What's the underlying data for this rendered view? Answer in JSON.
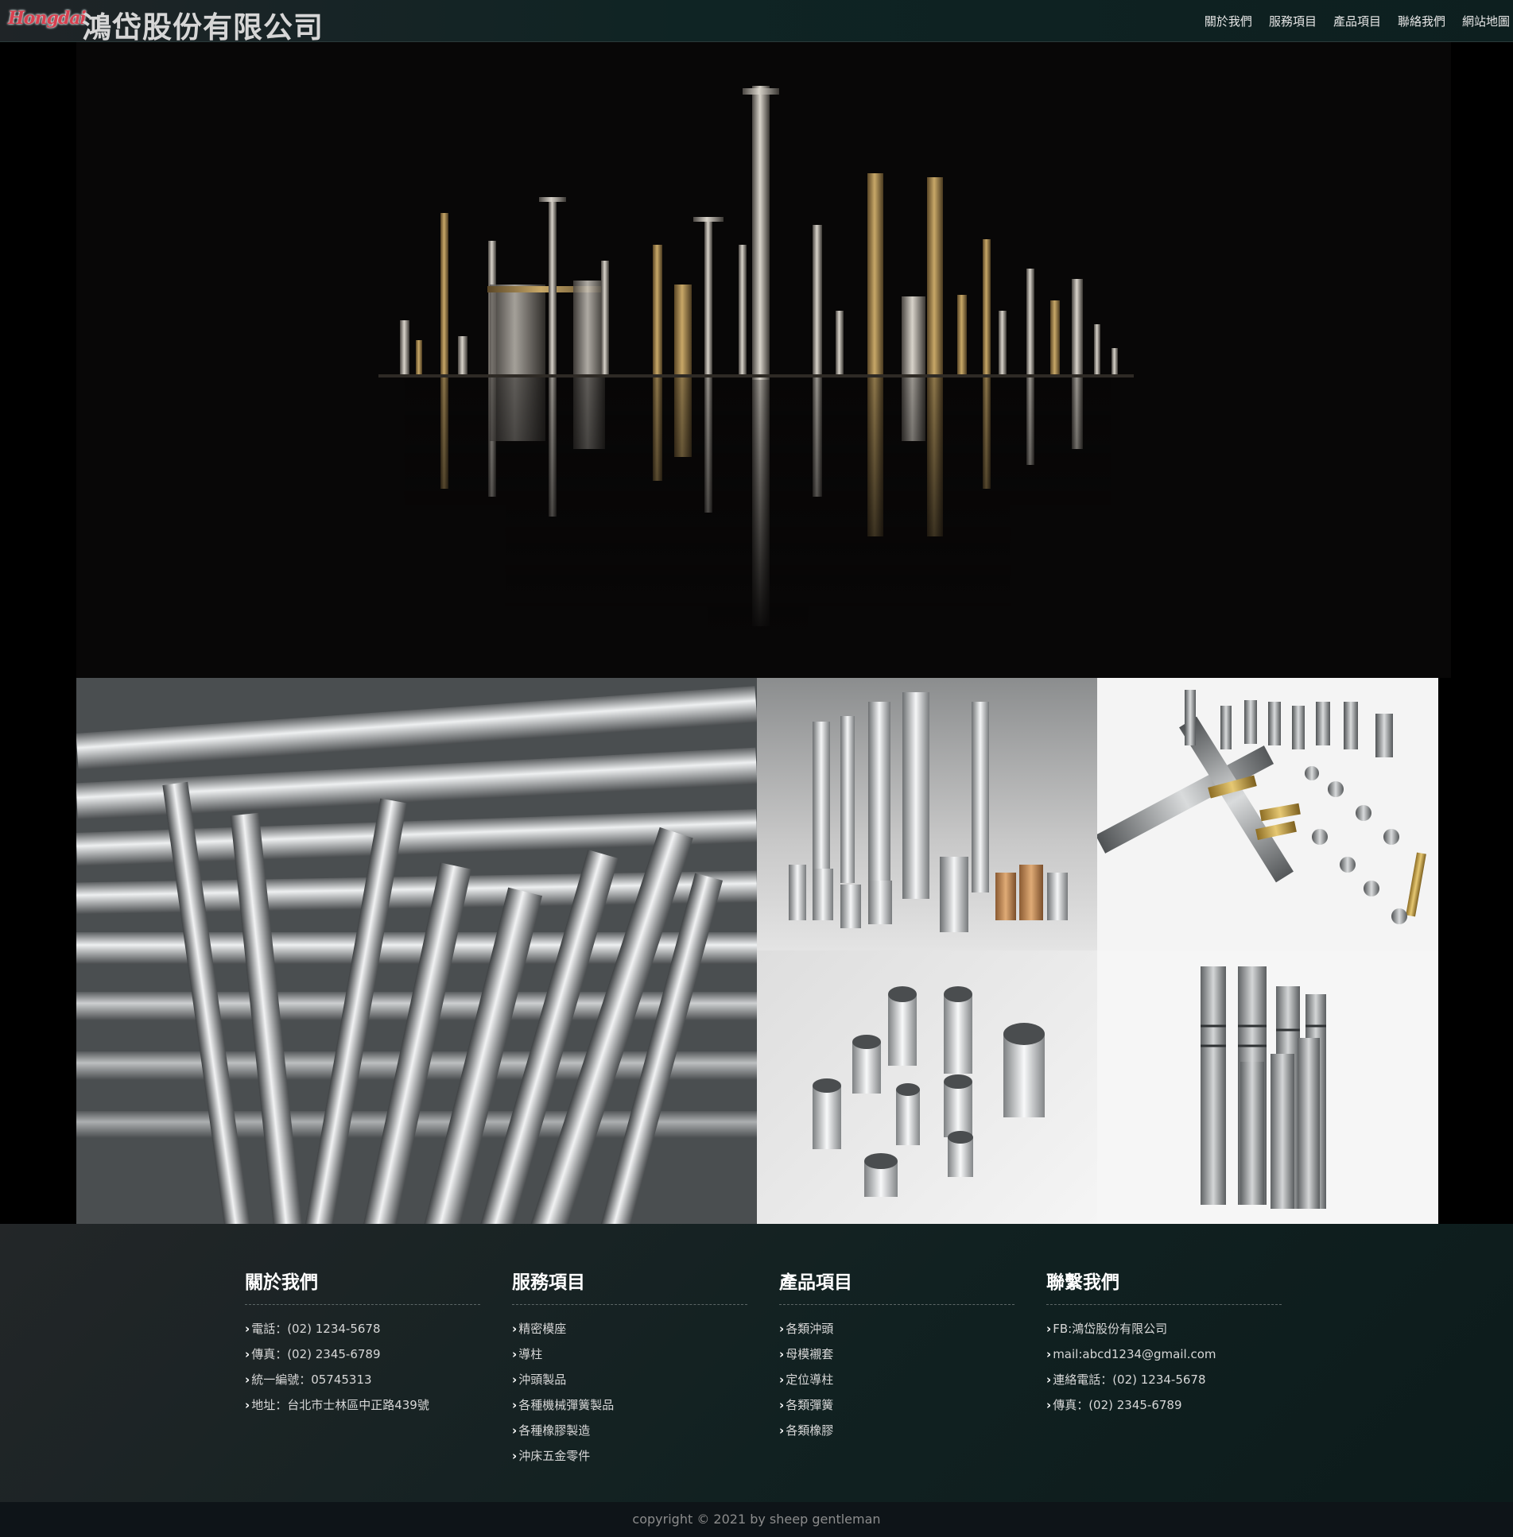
{
  "header": {
    "logo_text": "Hongdai",
    "brand": "鴻岱股份有限公司",
    "nav": [
      "關於我們",
      "服務項目",
      "產品項目",
      "聯絡我們",
      "網站地圖"
    ]
  },
  "footer": {
    "columns": [
      {
        "title": "關於我們",
        "items": [
          "電話：(02) 1234-5678",
          "傳真：(02) 2345-6789",
          "統一編號：05745313",
          "地址：台北市士林區中正路439號"
        ]
      },
      {
        "title": "服務項目",
        "items": [
          "精密模座",
          "導柱",
          "沖頭製品",
          "各種機械彈簧製品",
          "各種橡膠製造",
          "沖床五金零件"
        ]
      },
      {
        "title": "產品項目",
        "items": [
          "各類沖頭",
          "母模襯套",
          "定位導柱",
          "各類彈簧",
          "各類橡膠"
        ]
      },
      {
        "title": "聯繫我們",
        "items": [
          "FB:鴻岱股份有限公司",
          "mail:abcd1234@gmail.com",
          "連絡電話：(02) 1234-5678",
          "傳真：(02) 2345-6789"
        ]
      }
    ],
    "copyright": "copyright © 2021 by sheep gentleman"
  },
  "colors": {
    "logo": "#d9404f",
    "brand_text": "#d6d6d6",
    "header_bg": "#0f2424",
    "footer_bg": "#112121"
  },
  "icons": {
    "list_bullet": "chevron-right-icon"
  }
}
